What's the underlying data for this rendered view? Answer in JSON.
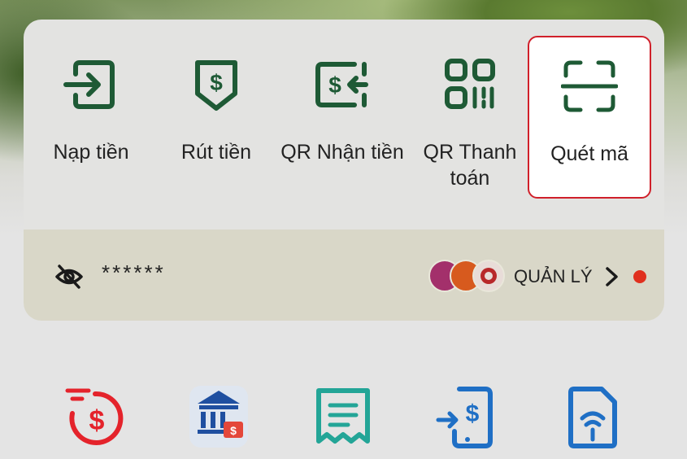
{
  "quick_actions": [
    {
      "label": "Nạp tiền",
      "icon": "deposit-icon"
    },
    {
      "label": "Rút tiền",
      "icon": "withdraw-icon"
    },
    {
      "label": "QR Nhận tiền",
      "icon": "qr-receive-icon"
    },
    {
      "label": "QR Thanh toán",
      "icon": "qr-pay-icon"
    },
    {
      "label": "Quét mã",
      "icon": "scan-icon",
      "selected": true
    }
  ],
  "balance": {
    "masked_value": "******",
    "manage_label": "QUẢN LÝ",
    "visibility_icon": "eye-off-icon",
    "notification_dot": true
  },
  "services": [
    {
      "icon": "cash-dollar-icon"
    },
    {
      "icon": "bank-icon"
    },
    {
      "icon": "receipt-icon"
    },
    {
      "icon": "transfer-icon"
    },
    {
      "icon": "sim-wifi-icon"
    }
  ],
  "colors": {
    "icon_green": "#1e5a35",
    "selection_red": "#d0202a",
    "notification": "#e0301e",
    "service_red": "#e4232b",
    "service_blue": "#1f6fc5",
    "service_teal": "#23a597"
  }
}
